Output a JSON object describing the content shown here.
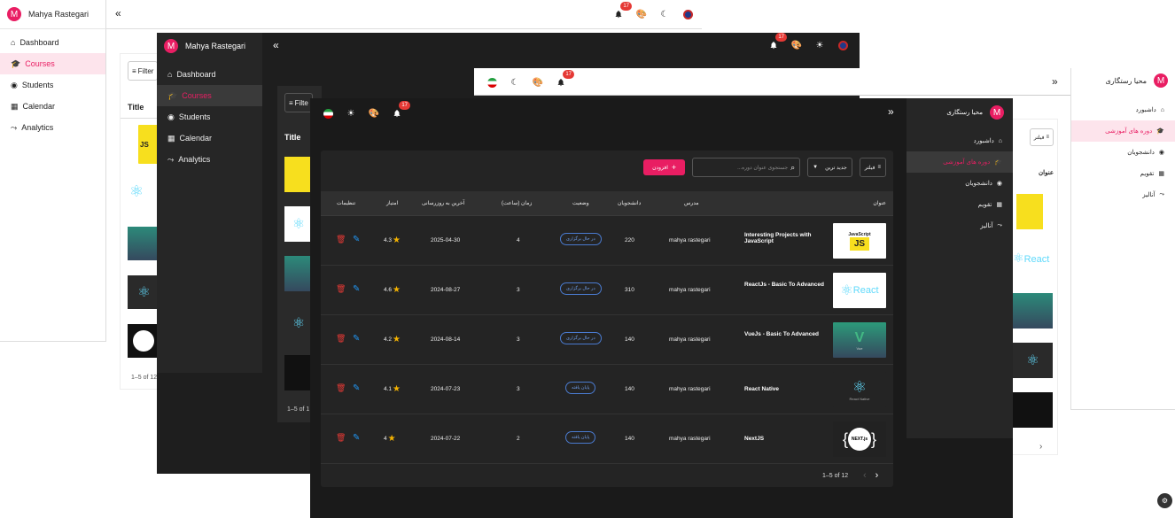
{
  "user": {
    "name_en": "Mahya Rastegari",
    "name_fa": "محیا رستگاری",
    "initial": "M"
  },
  "notifications": {
    "count": "17"
  },
  "nav_en": [
    "Dashboard",
    "Courses",
    "Students",
    "Calendar",
    "Analytics"
  ],
  "nav_fa": [
    "داشبورد",
    "دوره های آموزشی",
    "دانشجویان",
    "تقویم",
    "آنالیز"
  ],
  "light_en": {
    "filter": "Filter",
    "title_header": "Title",
    "pagination": "1–5 of 12"
  },
  "dark_en": {
    "filter": "Filte",
    "title_header": "Title",
    "pagination": "1–5 of 1"
  },
  "light_fa": {
    "filter": "فیلتر",
    "title_header": "عنوان"
  },
  "toolbar_fa": {
    "filter": "فیلتر",
    "sort": "جدید ترین",
    "search_placeholder": "جستجوی عنوان دوره...",
    "add": "افزودن"
  },
  "table_fa": {
    "headers": [
      "عنوان",
      "مدرس",
      "دانشجویان",
      "وضعیت",
      "زمان (ساعت)",
      "آخرین به روزرسانی",
      "امتیاز",
      "تنظیمات"
    ],
    "rows": [
      {
        "title": "Interesting Projects with JavaScript",
        "instructor": "mahya rastegari",
        "students": "220",
        "status": "در حال برگزاری",
        "hours": "4",
        "updated": "2025-04-30",
        "rating": "4.3",
        "thumb": "js"
      },
      {
        "title": "ReactJs - Basic To Advanced",
        "instructor": "mahya rastegari",
        "students": "310",
        "status": "در حال برگزاری",
        "hours": "3",
        "updated": "2024-08-27",
        "rating": "4.6",
        "thumb": "react"
      },
      {
        "title": "VueJs - Basic To Advanced",
        "instructor": "mahya rastegari",
        "students": "140",
        "status": "در حال برگزاری",
        "hours": "3",
        "updated": "2024-08-14",
        "rating": "4.2",
        "thumb": "vue"
      },
      {
        "title": "React Native",
        "instructor": "mahya rastegari",
        "students": "140",
        "status": "پایان یافته",
        "hours": "3",
        "updated": "2024-07-23",
        "rating": "4.1",
        "thumb": "rn"
      },
      {
        "title": "NextJS",
        "instructor": "mahya rastegari",
        "students": "140",
        "status": "پایان یافته",
        "hours": "2",
        "updated": "2024-07-22",
        "rating": "4",
        "thumb": "next"
      }
    ],
    "pagination": "1–5 of 12"
  },
  "thumb_text": {
    "js_label": "JavaScript",
    "js_mark": "JS",
    "react_word": "React",
    "vue_word": "Vue",
    "rn_word": "React Native",
    "next_word": "NEXT.js"
  },
  "colors": {
    "accent": "#e91e63",
    "dark_bg": "#1e1e1e",
    "dark_panel": "#262626",
    "star": "#f5b301",
    "delete": "#e53935",
    "edit": "#2196f3"
  }
}
